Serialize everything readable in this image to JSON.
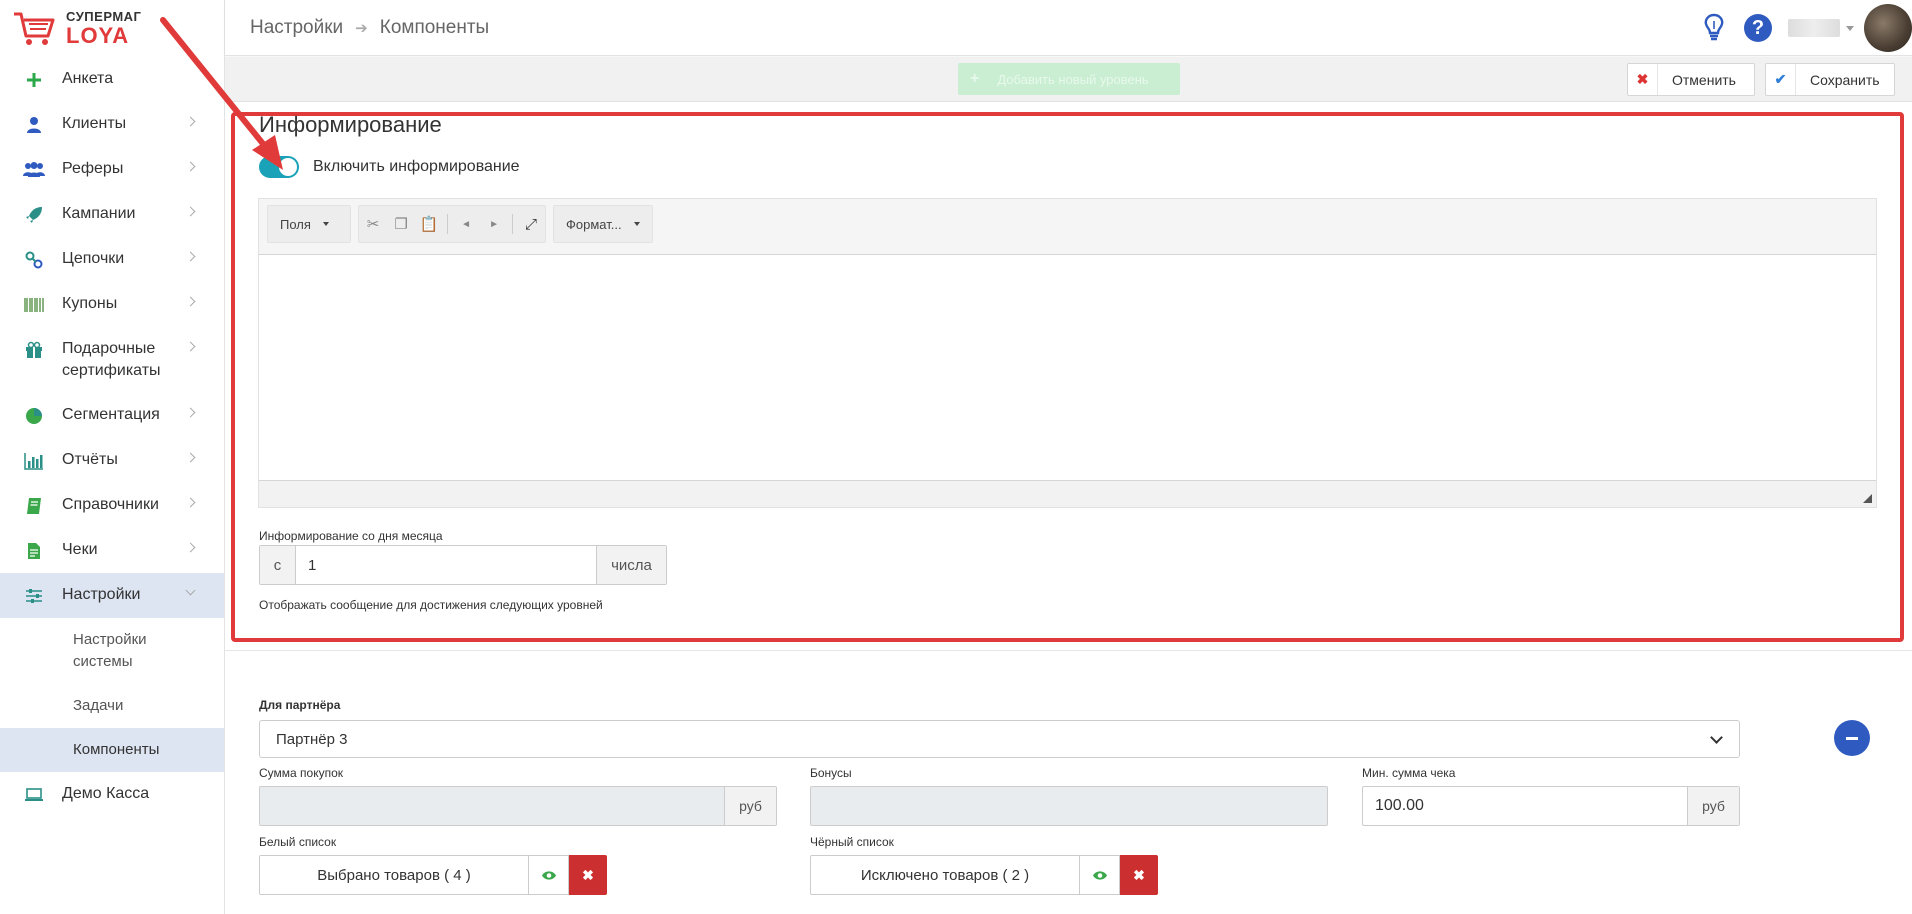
{
  "app": {
    "logo_top": "СУПЕРМАГ",
    "logo_bottom": "LOYA",
    "brand_color": "#e03a3a",
    "accent_color": "#2f5bc0"
  },
  "breadcrumb": {
    "items": [
      "Настройки",
      "Компоненты"
    ]
  },
  "sidebar": {
    "items": [
      {
        "label": "Анкета",
        "icon": "plus-icon"
      },
      {
        "label": "Клиенты",
        "icon": "user-icon"
      },
      {
        "label": "Реферы",
        "icon": "users-icon"
      },
      {
        "label": "Кампании",
        "icon": "rocket-icon"
      },
      {
        "label": "Цепочки",
        "icon": "link-icon"
      },
      {
        "label": "Купоны",
        "icon": "barcode-icon"
      },
      {
        "label": "Подарочные сертификаты",
        "icon": "gift-icon"
      },
      {
        "label": "Сегментация",
        "icon": "pie-chart-icon"
      },
      {
        "label": "Отчёты",
        "icon": "bar-chart-icon"
      },
      {
        "label": "Справочники",
        "icon": "book-icon"
      },
      {
        "label": "Чеки",
        "icon": "receipt-icon"
      },
      {
        "label": "Настройки",
        "icon": "sliders-icon"
      }
    ],
    "sub_items": [
      "Настройки системы",
      "Задачи",
      "Компоненты"
    ],
    "last_item": {
      "label": "Демо Касса",
      "icon": "laptop-icon"
    }
  },
  "toolbar": {
    "add_level": "Добавить новый уровень",
    "cancel": "Отменить",
    "save": "Сохранить"
  },
  "informing": {
    "title": "Информирование",
    "toggle_label": "Включить информирование",
    "toggle_on": true,
    "editor": {
      "fields_select": "Поля",
      "format_select": "Формат..."
    },
    "from_day_label": "Информирование со дня месяца",
    "from_day_prefix": "с",
    "from_day_value": "1",
    "from_day_suffix": "числа",
    "show_message_label": "Отображать сообщение для достижения следующих уровней"
  },
  "partner": {
    "label": "Для партнёра",
    "selected": "Партнёр 3",
    "purchase_sum_label": "Сумма покупок",
    "purchase_sum_value": "",
    "purchase_sum_unit": "руб",
    "bonuses_label": "Бонусы",
    "bonuses_value": "",
    "min_check_label": "Мин. сумма чека",
    "min_check_value": "100.00",
    "min_check_unit": "руб",
    "white_list_label": "Белый список",
    "white_list_value": "Выбрано товаров ( 4 )",
    "black_list_label": "Чёрный список",
    "black_list_value": "Исключено товаров ( 2 )"
  }
}
